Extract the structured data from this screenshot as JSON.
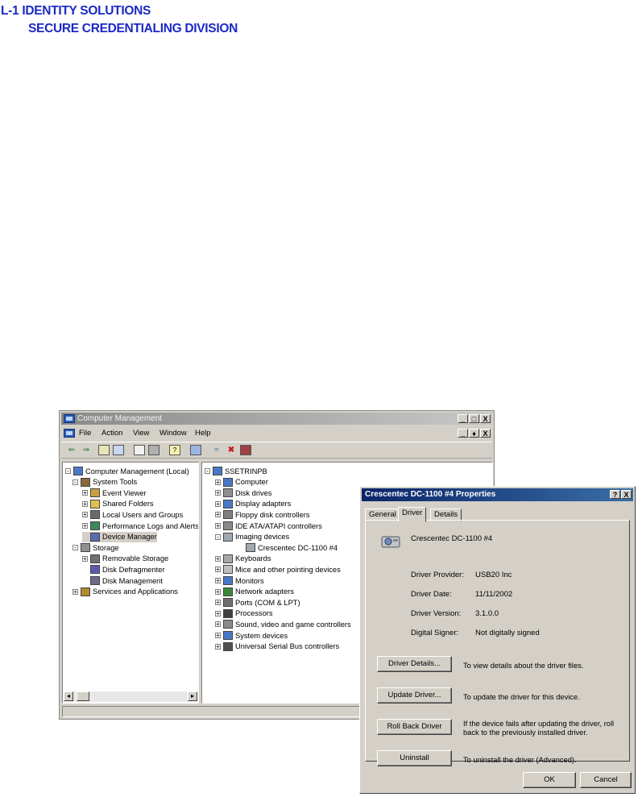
{
  "header": {
    "line1": "L-1 IDENTITY SOLUTIONS",
    "line2": "SECURE CREDENTIALING DIVISION"
  },
  "main_window": {
    "title": "Computer Management",
    "controls": [
      "_",
      "□",
      "X"
    ],
    "menu": [
      "File",
      "Action",
      "View",
      "Window",
      "Help"
    ],
    "menu_controls": [
      "_",
      "♦",
      "X"
    ],
    "left_tree": [
      {
        "label": "Computer Management (Local)",
        "expander": "-",
        "icon": "computer-icon"
      },
      {
        "label": "System Tools",
        "expander": "-",
        "icon": "tools-icon"
      },
      {
        "label": "Event Viewer",
        "expander": "+",
        "icon": "event-viewer-icon"
      },
      {
        "label": "Shared Folders",
        "expander": "+",
        "icon": "shared-folder-icon"
      },
      {
        "label": "Local Users and Groups",
        "expander": "+",
        "icon": "users-icon"
      },
      {
        "label": "Performance Logs and Alerts",
        "expander": "+",
        "icon": "performance-icon"
      },
      {
        "label": "Device Manager",
        "expander": "",
        "icon": "device-manager-icon",
        "selected": true
      },
      {
        "label": "Storage",
        "expander": "-",
        "icon": "storage-icon"
      },
      {
        "label": "Removable Storage",
        "expander": "+",
        "icon": "removable-storage-icon"
      },
      {
        "label": "Disk Defragmenter",
        "expander": "",
        "icon": "defrag-icon"
      },
      {
        "label": "Disk Management",
        "expander": "",
        "icon": "disk-management-icon"
      },
      {
        "label": "Services and Applications",
        "expander": "+",
        "icon": "services-icon"
      }
    ],
    "right_tree": [
      {
        "label": "SSETRINPB",
        "expander": "-",
        "icon": "computer-icon"
      },
      {
        "label": "Computer",
        "expander": "+",
        "icon": "computer-icon"
      },
      {
        "label": "Disk drives",
        "expander": "+",
        "icon": "disk-icon"
      },
      {
        "label": "Display adapters",
        "expander": "+",
        "icon": "display-icon"
      },
      {
        "label": "Floppy disk controllers",
        "expander": "+",
        "icon": "floppy-icon"
      },
      {
        "label": "IDE ATA/ATAPI controllers",
        "expander": "+",
        "icon": "ide-icon"
      },
      {
        "label": "Imaging devices",
        "expander": "-",
        "icon": "camera-icon"
      },
      {
        "label": "Crescentec DC-1100 #4",
        "expander": "",
        "icon": "camera-icon"
      },
      {
        "label": "Keyboards",
        "expander": "+",
        "icon": "keyboard-icon"
      },
      {
        "label": "Mice and other pointing devices",
        "expander": "+",
        "icon": "mouse-icon"
      },
      {
        "label": "Monitors",
        "expander": "+",
        "icon": "monitor-icon"
      },
      {
        "label": "Network adapters",
        "expander": "+",
        "icon": "network-icon"
      },
      {
        "label": "Ports (COM & LPT)",
        "expander": "+",
        "icon": "port-icon"
      },
      {
        "label": "Processors",
        "expander": "+",
        "icon": "processor-icon"
      },
      {
        "label": "Sound, video and game controllers",
        "expander": "+",
        "icon": "sound-icon"
      },
      {
        "label": "System devices",
        "expander": "+",
        "icon": "system-icon"
      },
      {
        "label": "Universal Serial Bus controllers",
        "expander": "+",
        "icon": "usb-icon"
      }
    ]
  },
  "dialog": {
    "title": "Crescentec DC-1100 #4 Properties",
    "help_btn": "?",
    "close_btn": "X",
    "tabs": [
      "General",
      "Driver",
      "Details"
    ],
    "device_name": "Crescentec DC-1100 #4",
    "fields": [
      {
        "label": "Driver Provider:",
        "value": "USB20 Inc"
      },
      {
        "label": "Driver Date:",
        "value": "11/11/2002"
      },
      {
        "label": "Driver Version:",
        "value": "3.1.0.0"
      },
      {
        "label": "Digital Signer:",
        "value": "Not digitally signed"
      }
    ],
    "actions": [
      {
        "button": "Driver Details...",
        "description": "To view details about the driver files."
      },
      {
        "button": "Update Driver...",
        "description": "To update the driver for this device."
      },
      {
        "button": "Roll Back Driver",
        "description": "If the device fails after updating the driver, roll back to the previously installed driver."
      },
      {
        "button": "Uninstall",
        "description": "To uninstall the driver (Advanced)."
      }
    ],
    "ok": "OK",
    "cancel": "Cancel"
  }
}
